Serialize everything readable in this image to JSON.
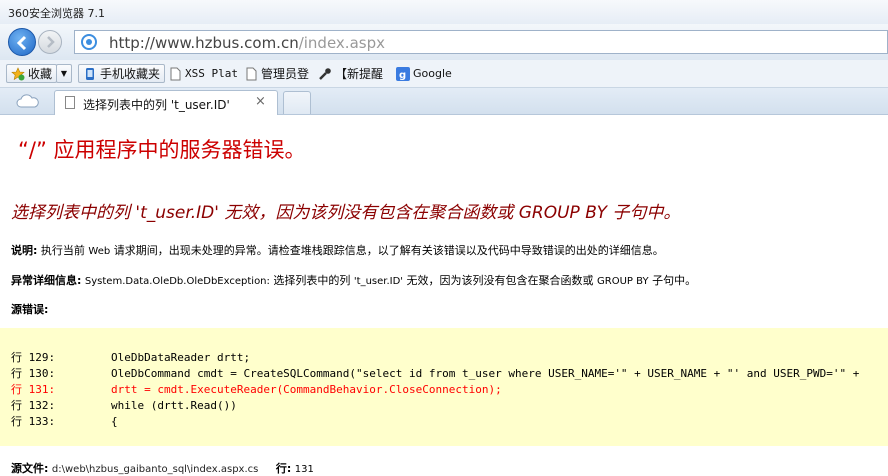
{
  "window": {
    "title": "360安全浏览器 7.1"
  },
  "address": {
    "url_main": "http://www.hzbus.com.cn",
    "url_rest": "/index.aspx"
  },
  "favorites": {
    "items": [
      "收藏",
      "手机收藏夹",
      "XSS Plat",
      "管理员登",
      "【新提醒",
      "Google"
    ]
  },
  "tabs": [
    {
      "label": "选择列表中的列 't_user.ID'",
      "close": "×"
    }
  ],
  "page": {
    "title": "“/” 应用程序中的服务器错误。",
    "error_heading": "选择列表中的列 't_user.ID' 无效，因为该列没有包含在聚合函数或 GROUP BY 子句中。",
    "desc_label": "说明:",
    "desc_pre": "执行当前",
    "desc_web": "Web",
    "desc_post": "请求期间，出现未处理的异常。请检查堆栈跟踪信息，以了解有关该错误以及代码中导致错误的出处的详细信息。",
    "exc_label": "异常详细信息:",
    "exc_type": "System.Data.OleDb.OleDbException:",
    "exc_msg1": "选择列表中的列",
    "exc_col": "'t_user.ID'",
    "exc_msg2": "无效，因为该列没有包含在聚合函数或",
    "exc_group": "GROUP BY",
    "exc_msg3": "子句中。",
    "src_label": "源错误:",
    "code_lines": [
      {
        "num": "行 129:",
        "code": "OleDbDataReader drtt;"
      },
      {
        "num": "行 130:",
        "code": "OleDbCommand cmdt = CreateSQLCommand(\"select id from t_user where USER_NAME='\" + USER_NAME + \"' and USER_PWD='\" +"
      },
      {
        "num": "行 131:",
        "code": "drtt = cmdt.ExecuteReader(CommandBehavior.CloseConnection);"
      },
      {
        "num": "行 132:",
        "code": "while (drtt.Read())"
      },
      {
        "num": "行 133:",
        "code": "{"
      }
    ],
    "src_file_label": "源文件:",
    "src_file": "d:\\web\\hzbus_gaibanto_sql\\index.aspx.cs",
    "line_label": "行:",
    "line_value": "131"
  },
  "colors": {
    "title_red": "#cc0000",
    "heading_darkred": "#8b0000",
    "code_bg": "#ffffcc",
    "error_line": "#ff0000"
  }
}
